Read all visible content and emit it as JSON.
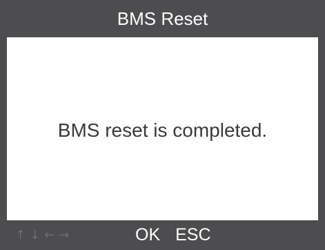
{
  "header": {
    "title": "BMS Reset"
  },
  "main": {
    "message": "BMS reset is completed."
  },
  "footer": {
    "nav_arrows": [
      {
        "icon": "arrow-up-icon",
        "glyph": "↑"
      },
      {
        "icon": "arrow-down-icon",
        "glyph": "↓"
      },
      {
        "icon": "arrow-left-icon",
        "glyph": "←"
      },
      {
        "icon": "arrow-right-icon",
        "glyph": "→"
      }
    ],
    "ok_label": "OK",
    "esc_label": "ESC"
  },
  "colors": {
    "bar_background": "#4d4d4f",
    "screen_background": "#ffffff",
    "message_text": "#3a3a3a",
    "inactive_arrow": "#6e6e70"
  }
}
